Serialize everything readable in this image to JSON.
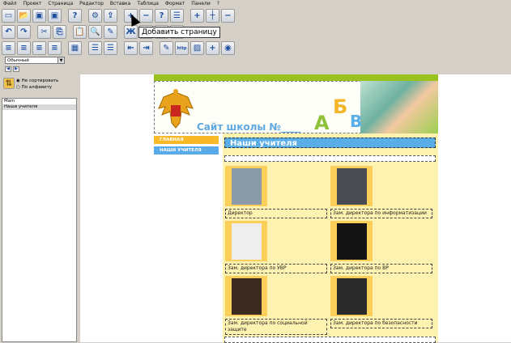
{
  "menu": [
    "Файл",
    "Проект",
    "Страница",
    "Редактор",
    "Вставка",
    "Таблица",
    "Формат",
    "Панели",
    "?"
  ],
  "toolbar1": [
    {
      "icon": "new-page-icon",
      "g": "▭"
    },
    {
      "icon": "open-folder-icon",
      "g": "📂"
    },
    {
      "icon": "save-icon",
      "g": "▣"
    },
    {
      "icon": "save-as-icon",
      "g": "▣"
    },
    {
      "icon": "help-folder-icon",
      "g": "?"
    },
    {
      "icon": "publish-icon",
      "g": "⚙"
    },
    {
      "icon": "upload-icon",
      "g": "⇪"
    },
    {
      "icon": "add-page-icon",
      "g": "+"
    },
    {
      "icon": "remove-page-icon",
      "g": "−"
    },
    {
      "icon": "page-help-icon",
      "g": "?"
    },
    {
      "icon": "page-list-icon",
      "g": "☰"
    },
    {
      "icon": "insert-row-icon",
      "g": "+"
    },
    {
      "icon": "insert-column-icon",
      "g": "┼"
    },
    {
      "icon": "delete-row-icon",
      "g": "−"
    }
  ],
  "toolbar2": [
    {
      "icon": "undo-icon",
      "g": "↶"
    },
    {
      "icon": "redo-icon",
      "g": "↷"
    },
    {
      "icon": "cut-icon",
      "g": "✂"
    },
    {
      "icon": "copy-icon",
      "g": "⎘"
    },
    {
      "icon": "paste-icon",
      "g": "📋"
    },
    {
      "icon": "find-icon",
      "g": "🔍"
    },
    {
      "icon": "format-brush-icon",
      "g": "✎"
    },
    {
      "icon": "bold-icon",
      "g": "Ж"
    },
    {
      "icon": "font-icon",
      "g": "A"
    },
    {
      "icon": "font-color-icon",
      "g": "A"
    },
    {
      "icon": "highlight-icon",
      "g": "A"
    }
  ],
  "toolbar3": [
    {
      "icon": "align-left-icon",
      "g": "≡"
    },
    {
      "icon": "align-center-icon",
      "g": "≡"
    },
    {
      "icon": "align-right-icon",
      "g": "≡"
    },
    {
      "icon": "justify-icon",
      "g": "≡"
    },
    {
      "icon": "image-icon",
      "g": "▦"
    },
    {
      "icon": "bullet-list-icon",
      "g": "☰"
    },
    {
      "icon": "numbered-list-icon",
      "g": "☰"
    },
    {
      "icon": "outdent-icon",
      "g": "⇤"
    },
    {
      "icon": "indent-icon",
      "g": "⇥"
    },
    {
      "icon": "edit-icon",
      "g": "✎"
    },
    {
      "icon": "link-icon",
      "g": "http"
    },
    {
      "icon": "picture-icon",
      "g": "▨"
    },
    {
      "icon": "add-block-icon",
      "g": "+"
    },
    {
      "icon": "compass-icon",
      "g": "◉"
    }
  ],
  "tooltip": "Добавить страницу",
  "style_select": "Обычный",
  "sort": {
    "option1": "Не сортировать",
    "option2": "По алфавиту"
  },
  "pages": [
    "Main",
    "Наши учителя"
  ],
  "site": {
    "title": "Сайт школы №____",
    "letters": [
      "А",
      "Б",
      "В"
    ],
    "nav": [
      "ГЛАВНАЯ",
      "НАШИ УЧИТЕЛЯ"
    ],
    "heading": "Наши учителя"
  },
  "teachers": [
    "Директор",
    "Зам. директора по информатизации",
    "Зам. директора по УВР",
    "Зам. директора по ВР",
    "Зам. директора по социальной защите",
    "Зам. директора по безопасности"
  ],
  "colors": {
    "green": "#99c21f",
    "orange": "#f7b928",
    "blue": "#58abe8",
    "content_bg": "#fdf2b0"
  }
}
